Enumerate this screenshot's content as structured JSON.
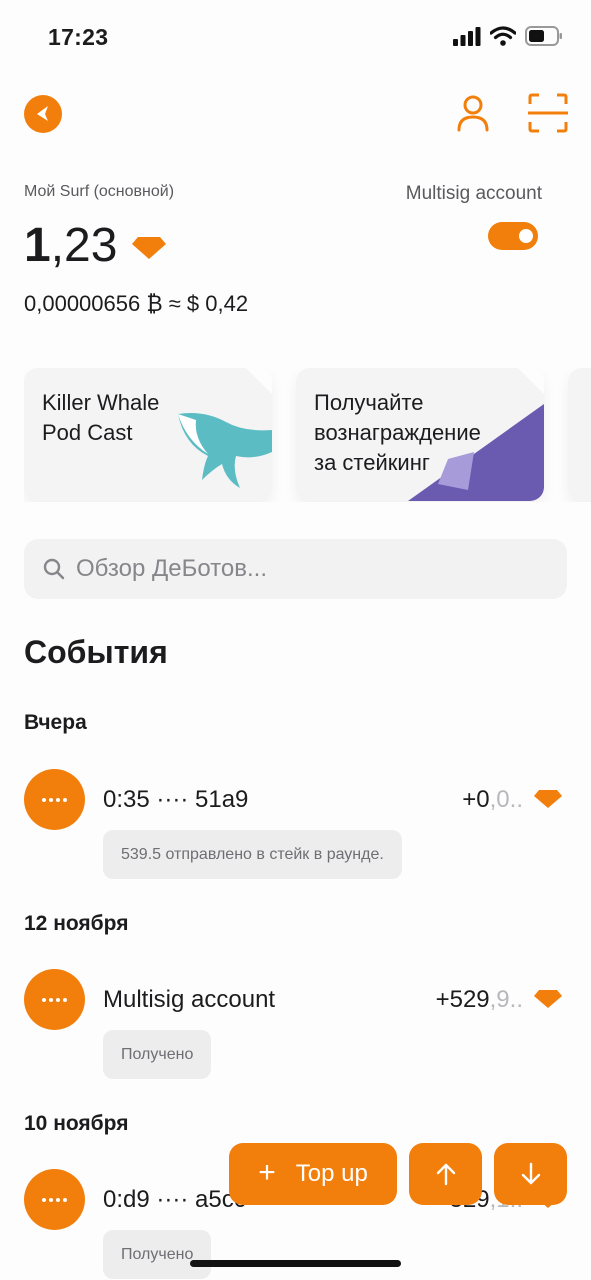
{
  "status_bar": {
    "time": "17:23"
  },
  "header": {
    "back_icon": "back-arrow-icon",
    "profile_icon": "person-icon",
    "scan_icon": "scan-icon"
  },
  "account": {
    "name": "Мой Surf (основной)",
    "balance_integer": "1",
    "balance_fraction": ",23",
    "fiat_line": "0,00000656 ₿ ≈ $ 0,42",
    "multisig_label": "Multisig account",
    "multisig_toggle_on": true
  },
  "cards": [
    {
      "text_line1": "Killer Whale",
      "text_line2": "Pod Cast"
    },
    {
      "text_line1": "Получайте",
      "text_line2": "вознаграждение",
      "text_line3": "за стейкинг"
    }
  ],
  "search": {
    "placeholder": "Обзор ДеБотов..."
  },
  "events": {
    "title": "События",
    "groups": [
      {
        "day": "Вчера",
        "items": [
          {
            "title": "0:35 ···· 51a9",
            "amount_main": "+0",
            "amount_fade": ",0..",
            "note": "539.5 отправлено в стейк в раунде."
          }
        ]
      },
      {
        "day": "12 ноября",
        "items": [
          {
            "title": "Multisig account",
            "amount_main": "+529",
            "amount_fade": ",9..",
            "note": "Получено"
          }
        ]
      },
      {
        "day": "10 ноября",
        "items": [
          {
            "title": "0:d9 ···· a5c0",
            "amount_main": "+529",
            "amount_fade": ",1..",
            "note": "Получено"
          }
        ]
      }
    ]
  },
  "actions": {
    "topup_label": "Top up",
    "send_icon": "arrow-up-icon",
    "receive_icon": "arrow-down-icon"
  },
  "colors": {
    "accent": "#f27f0c",
    "whale": "#5bbcc4",
    "staking_purple": "#6a5bb1"
  }
}
